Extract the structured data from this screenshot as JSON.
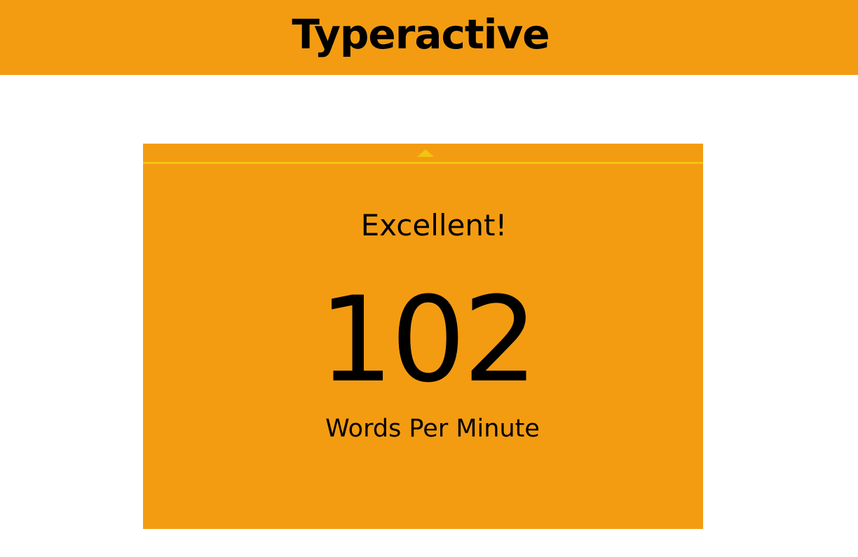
{
  "header": {
    "title": "Typeractive",
    "background_color": "#f39c12"
  },
  "result_card": {
    "toggle_icon": "caret-up-icon",
    "rating": "Excellent!",
    "wpm_value": "102",
    "wpm_label": "Words Per Minute",
    "background_color": "#f39c12",
    "accent_color": "#f1c40f"
  }
}
